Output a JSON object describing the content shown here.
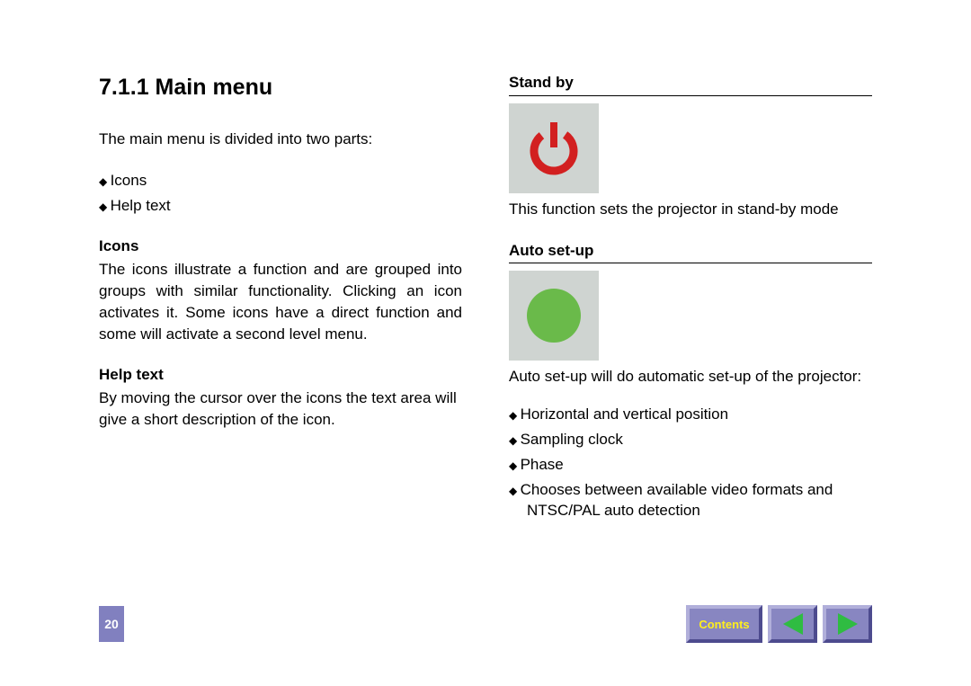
{
  "left": {
    "heading": "7.1.1 Main menu",
    "intro": "The main menu is divided into two parts:",
    "bullets": [
      "Icons",
      "Help text"
    ],
    "icons_head": "Icons",
    "icons_body": "The icons illustrate a function and are grouped into groups with similar functionality. Clicking an icon activates it. Some icons have a direct function and some will activate a second level menu.",
    "help_head": "Help text",
    "help_body": "By moving the cursor over the icons the text area will give a short description of the icon."
  },
  "right": {
    "standby_head": "Stand by",
    "standby_desc": "This function sets the projector in stand-by mode",
    "autosetup_head": "Auto set-up",
    "autosetup_desc": "Auto set-up will do automatic set-up of the projector:",
    "autosetup_bullets": [
      "Horizontal and vertical position",
      "Sampling clock",
      "Phase",
      "Chooses between available video formats and NTSC/PAL auto detection"
    ]
  },
  "footer": {
    "page_num": "20",
    "contents": "Contents"
  },
  "icons": {
    "standby": "power-icon",
    "autosetup": "green-circle-icon"
  }
}
